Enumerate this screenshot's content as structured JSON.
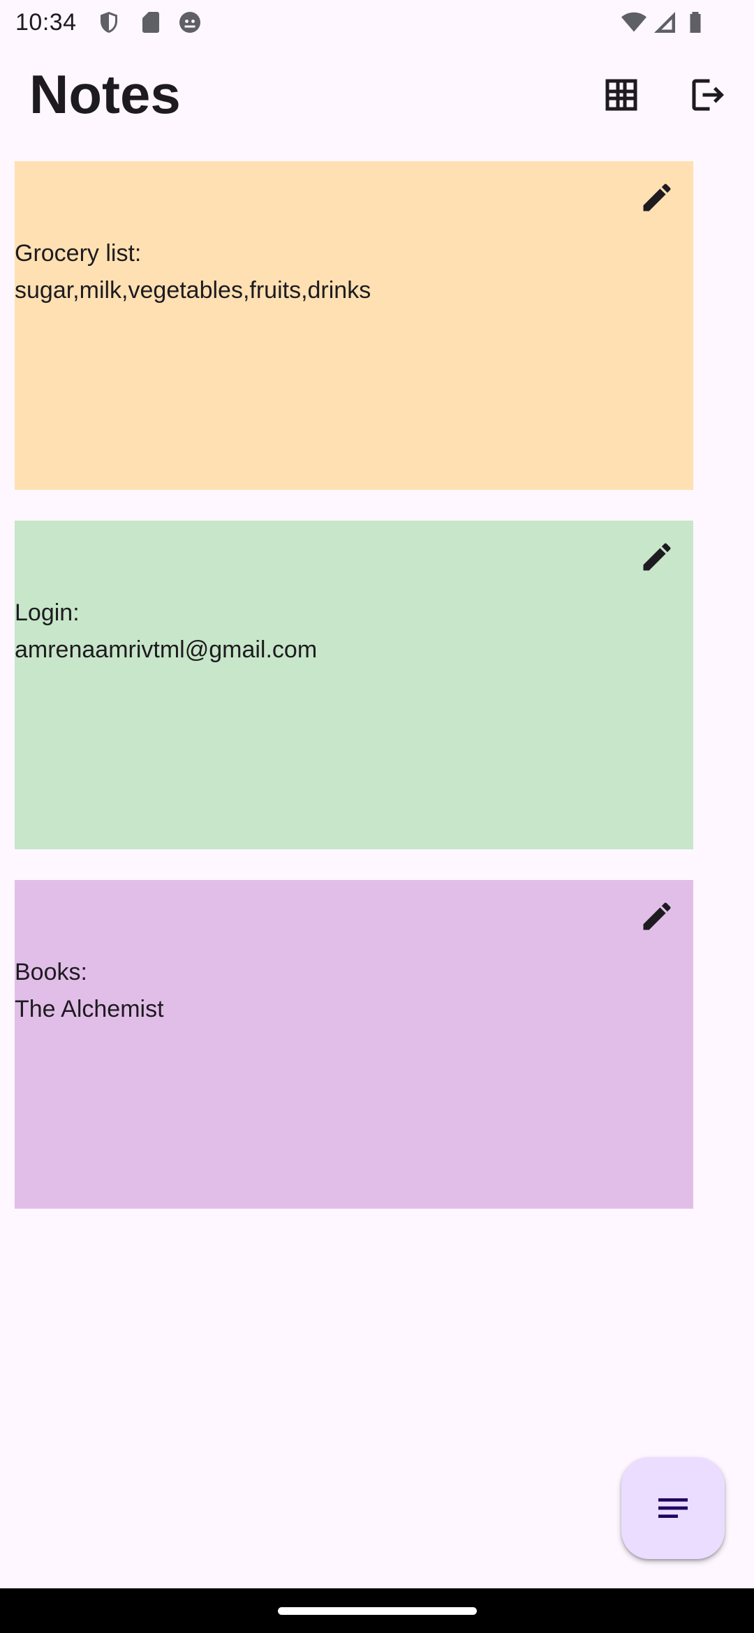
{
  "status_bar": {
    "time": "10:34",
    "icons_left": [
      "shield-icon",
      "sd-card-icon",
      "android-icon"
    ],
    "icons_right": [
      "wifi-icon",
      "signal-icon",
      "battery-icon"
    ]
  },
  "app_bar": {
    "title": "Notes",
    "actions": [
      "grid-view-icon",
      "logout-icon"
    ]
  },
  "notes": [
    {
      "text": "Grocery list:\nsugar,milk,vegetables,fruits,drinks",
      "color": "#FFE0B2",
      "icon": "edit-icon"
    },
    {
      "text": "Login:\namrenaamrivtml@gmail.com",
      "color": "#C8E6C9",
      "icon": "edit-icon"
    },
    {
      "text": "Books:\nThe Alchemist",
      "color": "#E1BEE7",
      "icon": "edit-icon"
    }
  ],
  "fab": {
    "icon": "sort-icon",
    "background": "#EADDFF"
  },
  "colors": {
    "background": "#FEF7FF",
    "text": "#1D1B20",
    "fab_icon": "#21005D"
  }
}
